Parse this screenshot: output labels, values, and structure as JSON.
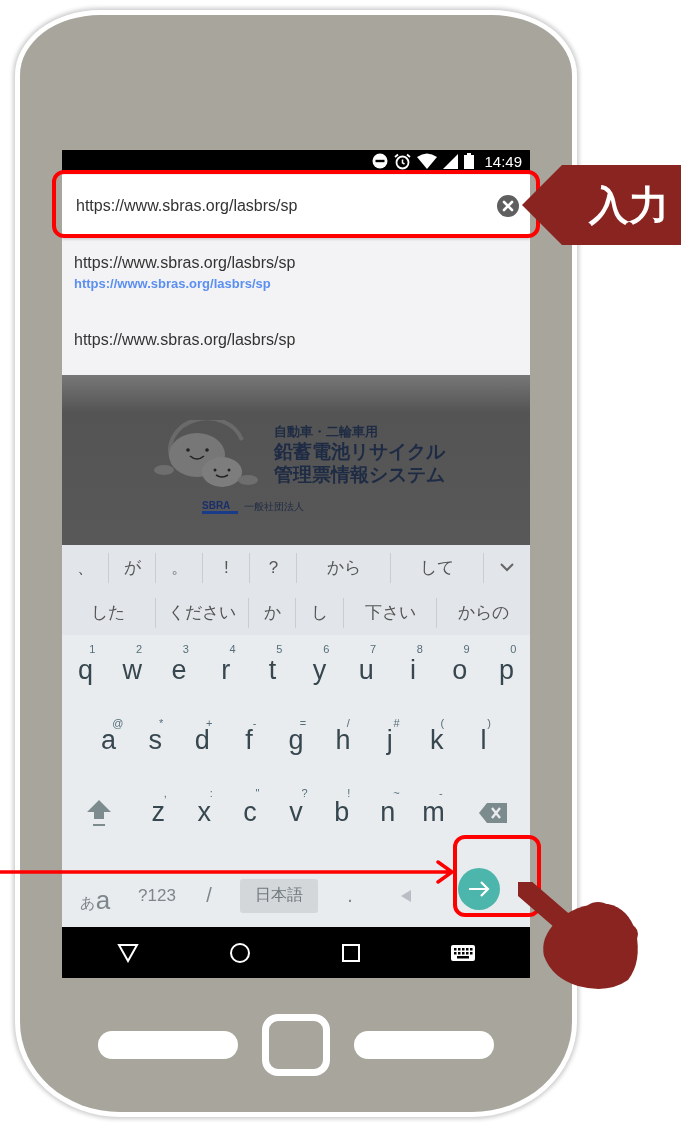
{
  "status_bar": {
    "time": "14:49"
  },
  "address_bar": {
    "value": "https://www.sbras.org/lasbrs/sp"
  },
  "suggestions": [
    {
      "title": "https://www.sbras.org/lasbrs/sp",
      "url": "https://www.sbras.org/lasbrs/sp"
    },
    {
      "title": "https://www.sbras.org/lasbrs/sp"
    }
  ],
  "web_page": {
    "subtitle": "自動車・二輪車用",
    "title_lines": [
      "鉛蓄電池リサイクル",
      "管理票情報システム"
    ],
    "logo_text": "SBRA",
    "org_type": "一般社団法人"
  },
  "keyboard": {
    "candidates": [
      [
        "、",
        "が",
        "。",
        "!",
        "?",
        "から",
        "して"
      ],
      [
        "した",
        "ください",
        "か",
        "し",
        "下さい",
        "からの"
      ]
    ],
    "rows": [
      [
        {
          "key": "q",
          "hint": "1"
        },
        {
          "key": "w",
          "hint": "2"
        },
        {
          "key": "e",
          "hint": "3"
        },
        {
          "key": "r",
          "hint": "4"
        },
        {
          "key": "t",
          "hint": "5"
        },
        {
          "key": "y",
          "hint": "6"
        },
        {
          "key": "u",
          "hint": "7"
        },
        {
          "key": "i",
          "hint": "8"
        },
        {
          "key": "o",
          "hint": "9"
        },
        {
          "key": "p",
          "hint": "0"
        }
      ],
      [
        {
          "key": "a",
          "hint": "@"
        },
        {
          "key": "s",
          "hint": "*"
        },
        {
          "key": "d",
          "hint": "+"
        },
        {
          "key": "f",
          "hint": "-"
        },
        {
          "key": "g",
          "hint": "="
        },
        {
          "key": "h",
          "hint": "/"
        },
        {
          "key": "j",
          "hint": "#"
        },
        {
          "key": "k",
          "hint": "("
        },
        {
          "key": "l",
          "hint": ")"
        }
      ],
      [
        {
          "key": "z",
          "hint": ","
        },
        {
          "key": "x",
          "hint": ":"
        },
        {
          "key": "c",
          "hint": "\""
        },
        {
          "key": "v",
          "hint": "?"
        },
        {
          "key": "b",
          "hint": "!"
        },
        {
          "key": "n",
          "hint": "~"
        },
        {
          "key": "m",
          "hint": "-"
        }
      ]
    ],
    "bottom_row": {
      "kana_key": "あ",
      "latin_key": "a",
      "symbols_key": "?123",
      "slash_key": "/",
      "space_key": "日本語",
      "period_key": "."
    }
  },
  "callout": {
    "label": "入力"
  }
}
